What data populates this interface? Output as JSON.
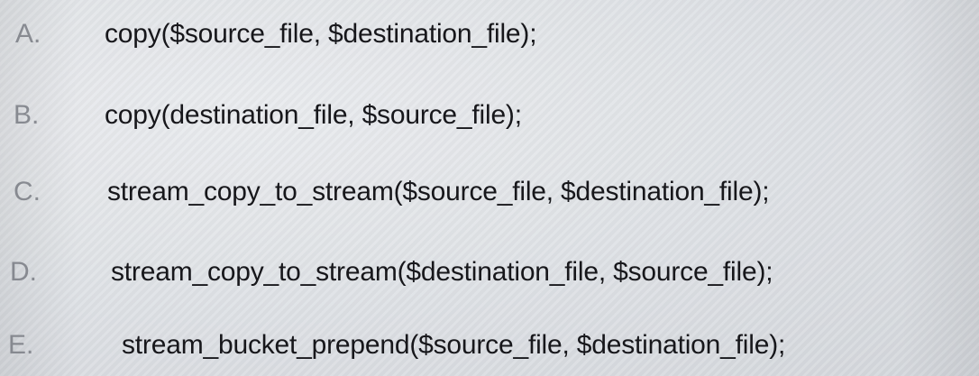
{
  "options": [
    {
      "letter": "A.",
      "code": "copy($source_file, $destination_file);"
    },
    {
      "letter": "B.",
      "code": "copy(destination_file, $source_file);"
    },
    {
      "letter": "C.",
      "code": "stream_copy_to_stream($source_file, $destination_file);"
    },
    {
      "letter": "D.",
      "code": "stream_copy_to_stream($destination_file, $source_file);"
    },
    {
      "letter": "E.",
      "code": "stream_bucket_prepend($source_file, $destination_file);"
    }
  ]
}
